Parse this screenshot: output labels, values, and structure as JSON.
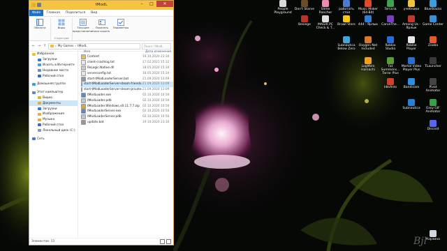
{
  "window": {
    "title": "tModL",
    "controls": [
      "–",
      "□",
      "✕"
    ],
    "tabs": [
      "Файл",
      "Главная",
      "Поделиться",
      "Вид"
    ],
    "ribbon": {
      "groups": [
        {
          "label": "Области",
          "buttons": [
            "Области"
          ]
        },
        {
          "label": "Структура",
          "buttons": [
            "Виды"
          ]
        },
        {
          "label": "",
          "buttons": [
            "Текущее представление",
            "Показать или скрыть",
            "Параметры"
          ]
        }
      ]
    },
    "address": {
      "path": [
        "My Games",
        "tModL"
      ],
      "search_placeholder": "Поиск: tModL"
    },
    "nav": {
      "favorites": {
        "label": "Избранное",
        "items": [
          "Загрузки",
          "Искать в Интернете",
          "Недавние места",
          "Рабочий стол"
        ]
      },
      "homegroup": "Домашняя группа",
      "computer": {
        "label": "Этот компьютер",
        "items": [
          "Видео",
          "Документы",
          "Загрузки",
          "Изображения",
          "Музыка",
          "Рабочий стол",
          "Локальный диск (C:)"
        ]
      },
      "network": "Сеть"
    },
    "columns": {
      "name": "Имя",
      "date": "Дата изменения"
    },
    "files": [
      {
        "name": "Content",
        "date": "19.10.2020 23:30",
        "type": "folder"
      },
      {
        "name": "client-crashlog.txt",
        "date": "27.02.2021 15:32",
        "type": "txt"
      },
      {
        "name": "ReLogic.Native.dll",
        "date": "18.05.2020 15:34",
        "type": "dll"
      },
      {
        "name": "serverconfig.txt",
        "date": "18.05.2020 15:34",
        "type": "txt"
      },
      {
        "name": "start-tModLoaderServer.bat",
        "date": "21.09.2020 13:09",
        "type": "bat"
      },
      {
        "name": "start-tModLoaderServer-steam-friends.bat",
        "date": "21.09.2020 13:09",
        "type": "bat"
      },
      {
        "name": "start-tModLoaderServer-steam-private.bat",
        "date": "21.09.2020 13:09",
        "type": "bat"
      },
      {
        "name": "tModLoader.exe",
        "date": "02.10.2020 10:56",
        "type": "exe"
      },
      {
        "name": "tModLoader.pdb",
        "date": "02.10.2020 10:56",
        "type": "pdb"
      },
      {
        "name": "tModLoader.Windows.v0.11.7.7.zip",
        "date": "02.10.2020 10:56",
        "type": "zip"
      },
      {
        "name": "tModLoaderServer.exe",
        "date": "02.10.2020 10:56",
        "type": "exe"
      },
      {
        "name": "tModLoaderServer.pdb",
        "date": "02.10.2020 10:56",
        "type": "pdb"
      },
      {
        "name": "update.bat",
        "date": "19.10.2020 23:30",
        "type": "bat"
      }
    ],
    "selected_file_index": 5,
    "status": "Элементов: 13"
  },
  "desktop_icons": [
    {
      "label": "People Playground",
      "color": "#d9d9d9"
    },
    {
      "label": "Don't Starve",
      "color": "#6b4c2a"
    },
    {
      "label": "Slime Rancher",
      "color": "#f08ab0"
    },
    {
      "label": "работать стол",
      "color": "#4a7bd0"
    },
    {
      "label": "Music Maker (64-Bit)",
      "color": "#e04a2a"
    },
    {
      "label": "Terraria",
      "color": "#3ea34b"
    },
    {
      "label": "учебники",
      "color": "#f0c040"
    },
    {
      "label": "BlueStacks",
      "color": "#3aa0e0"
    },
    {
      "label": "Besiege",
      "color": "#b8342a"
    },
    {
      "label": "MAGIX PC Check & T...",
      "color": "#e0e0e0"
    },
    {
      "label": "Brawl Stars",
      "color": "#f5c518"
    },
    {
      "label": "444 - Ярлык",
      "color": "#2f7ed8"
    },
    {
      "label": "CarveThe...",
      "color": "#7a3fc0"
    },
    {
      "label": "Among Us - Ярлык",
      "color": "#c0392b"
    },
    {
      "label": "Game Center",
      "color": "#3a8fd8"
    },
    {
      "label": "Subnautica Below Zero",
      "color": "#3fa7d6"
    },
    {
      "label": "Oxygen Not Included",
      "color": "#d8782a"
    },
    {
      "label": "Roblox Studio",
      "color": "#2b6bd8"
    },
    {
      "label": "Roblox Player",
      "color": "#e8e8e8"
    },
    {
      "label": "Zooba",
      "color": "#e85a2a"
    },
    {
      "label": "LogMeIn Hamachi",
      "color": "#f0a020"
    },
    {
      "label": "Fat Summons... Tarrar Plus",
      "color": "#5a9a3a"
    },
    {
      "label": "Mortal Video Player Plus",
      "color": "#2a6fd0"
    },
    {
      "label": "TLauncher",
      "color": "#3a3a3a"
    },
    {
      "label": "IdleAnts",
      "color": "#d0402a"
    },
    {
      "label": "Bandicam",
      "color": "#2a8fe0"
    },
    {
      "label": "Pivot Animator",
      "color": "#444444"
    },
    {
      "label": "Subnautica",
      "color": "#2a7fd6"
    },
    {
      "label": "Easy GIF Animator",
      "color": "#3aa04a"
    },
    {
      "label": "Discord",
      "color": "#5865f2"
    },
    {
      "label": "Корзина",
      "color": "#d0d8e0"
    }
  ]
}
